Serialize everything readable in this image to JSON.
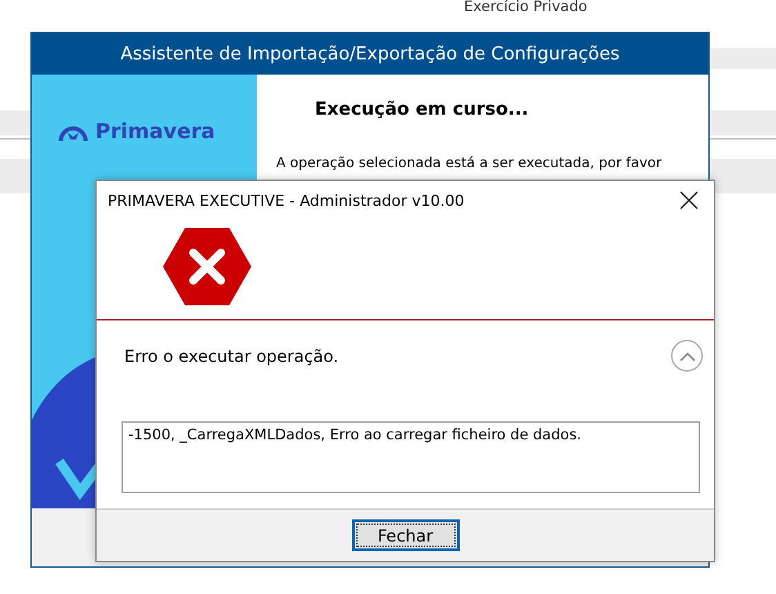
{
  "background": {
    "label": "Exercício Privado"
  },
  "wizard": {
    "title": "Assistente de Importação/Exportação de Configurações",
    "logo_text": "Primavera",
    "heading": "Execução em curso...",
    "message": "A operação selecionada está a ser executada, por favor"
  },
  "dialog": {
    "title": "PRIMAVERA EXECUTIVE - Administrador v10.00",
    "message": "Erro o executar operação.",
    "details_expanded": true,
    "details": "-1500, _CarregaXMLDados, Erro ao carregar ficheiro de dados.",
    "buttons": [
      "Fechar"
    ]
  }
}
